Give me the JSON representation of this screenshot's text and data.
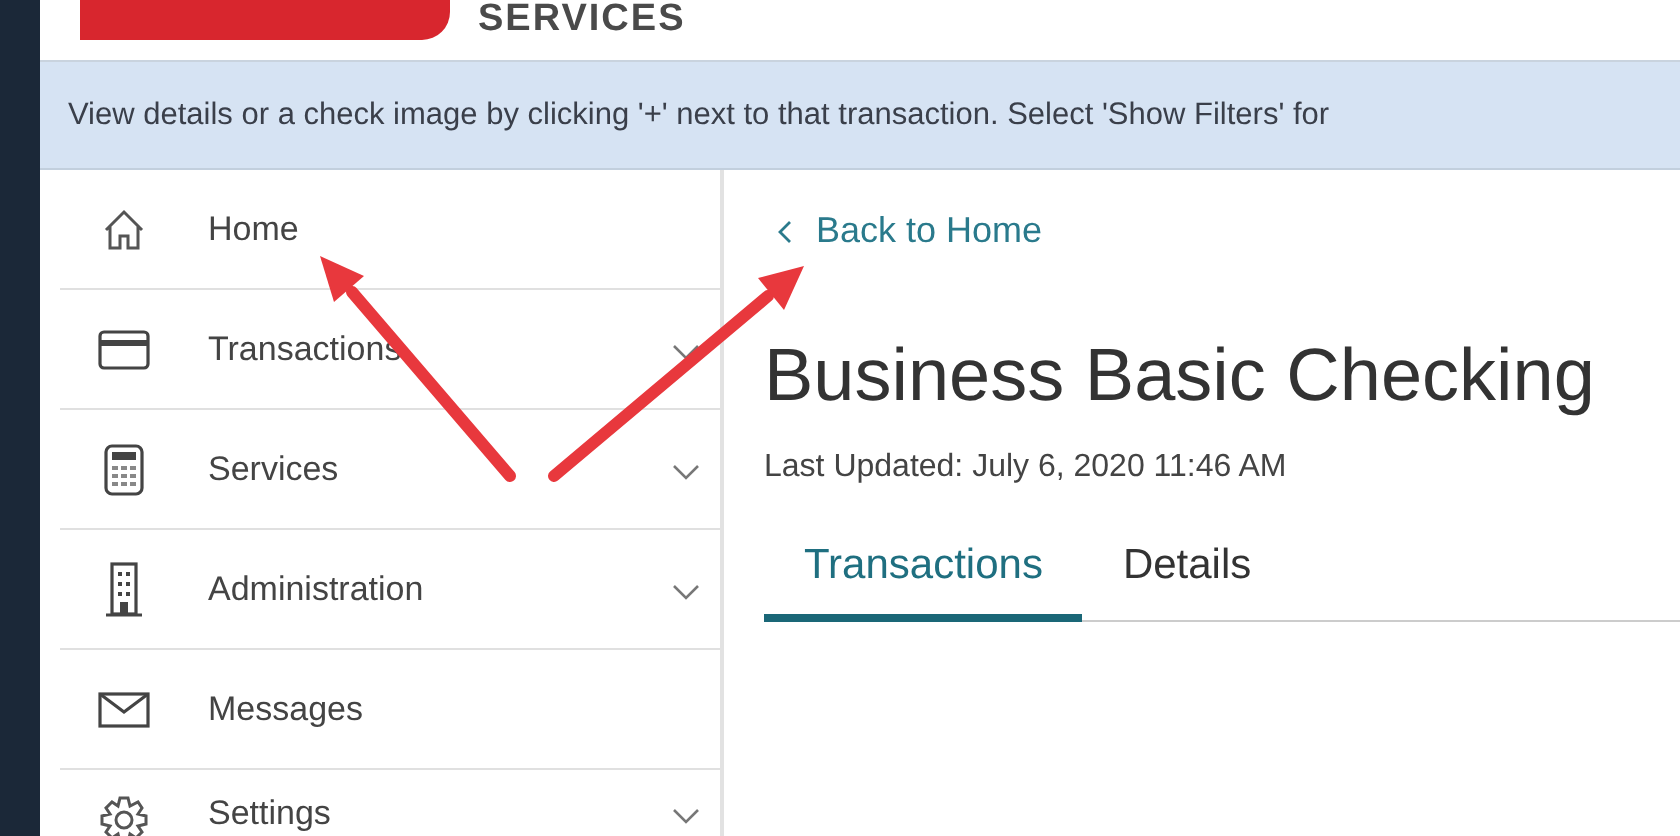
{
  "header": {
    "brand_text": "SERVICES"
  },
  "banner": {
    "text": "View details or a check image by clicking '+' next to that transaction. Select 'Show Filters' for"
  },
  "sidebar": {
    "items": [
      {
        "label": "Home",
        "kind": "home",
        "expandable": false
      },
      {
        "label": "Transactions",
        "kind": "card",
        "expandable": true
      },
      {
        "label": "Services",
        "kind": "calculator",
        "expandable": true
      },
      {
        "label": "Administration",
        "kind": "building",
        "expandable": true
      },
      {
        "label": "Messages",
        "kind": "envelope",
        "expandable": false
      },
      {
        "label": "Settings",
        "kind": "gear",
        "expandable": true
      }
    ]
  },
  "main": {
    "back_link": "Back to Home",
    "title": "Business Basic Checking",
    "last_updated": "Last Updated: July 6, 2020 11:46 AM",
    "tabs": [
      {
        "label": "Transactions",
        "selected": true
      },
      {
        "label": "Details",
        "selected": false
      }
    ]
  }
}
